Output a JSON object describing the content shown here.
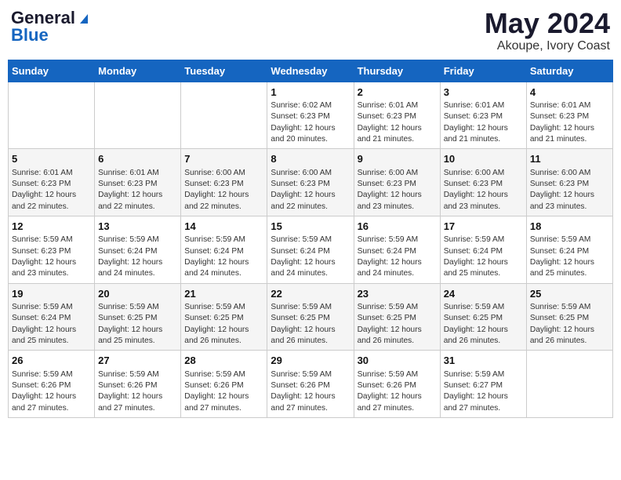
{
  "header": {
    "logo_line1": "General",
    "logo_line2": "Blue",
    "title": "May 2024",
    "subtitle": "Akoupe, Ivory Coast"
  },
  "days_of_week": [
    "Sunday",
    "Monday",
    "Tuesday",
    "Wednesday",
    "Thursday",
    "Friday",
    "Saturday"
  ],
  "weeks": [
    [
      {
        "day": "",
        "info": ""
      },
      {
        "day": "",
        "info": ""
      },
      {
        "day": "",
        "info": ""
      },
      {
        "day": "1",
        "info": "Sunrise: 6:02 AM\nSunset: 6:23 PM\nDaylight: 12 hours\nand 20 minutes."
      },
      {
        "day": "2",
        "info": "Sunrise: 6:01 AM\nSunset: 6:23 PM\nDaylight: 12 hours\nand 21 minutes."
      },
      {
        "day": "3",
        "info": "Sunrise: 6:01 AM\nSunset: 6:23 PM\nDaylight: 12 hours\nand 21 minutes."
      },
      {
        "day": "4",
        "info": "Sunrise: 6:01 AM\nSunset: 6:23 PM\nDaylight: 12 hours\nand 21 minutes."
      }
    ],
    [
      {
        "day": "5",
        "info": "Sunrise: 6:01 AM\nSunset: 6:23 PM\nDaylight: 12 hours\nand 22 minutes."
      },
      {
        "day": "6",
        "info": "Sunrise: 6:01 AM\nSunset: 6:23 PM\nDaylight: 12 hours\nand 22 minutes."
      },
      {
        "day": "7",
        "info": "Sunrise: 6:00 AM\nSunset: 6:23 PM\nDaylight: 12 hours\nand 22 minutes."
      },
      {
        "day": "8",
        "info": "Sunrise: 6:00 AM\nSunset: 6:23 PM\nDaylight: 12 hours\nand 22 minutes."
      },
      {
        "day": "9",
        "info": "Sunrise: 6:00 AM\nSunset: 6:23 PM\nDaylight: 12 hours\nand 23 minutes."
      },
      {
        "day": "10",
        "info": "Sunrise: 6:00 AM\nSunset: 6:23 PM\nDaylight: 12 hours\nand 23 minutes."
      },
      {
        "day": "11",
        "info": "Sunrise: 6:00 AM\nSunset: 6:23 PM\nDaylight: 12 hours\nand 23 minutes."
      }
    ],
    [
      {
        "day": "12",
        "info": "Sunrise: 5:59 AM\nSunset: 6:23 PM\nDaylight: 12 hours\nand 23 minutes."
      },
      {
        "day": "13",
        "info": "Sunrise: 5:59 AM\nSunset: 6:24 PM\nDaylight: 12 hours\nand 24 minutes."
      },
      {
        "day": "14",
        "info": "Sunrise: 5:59 AM\nSunset: 6:24 PM\nDaylight: 12 hours\nand 24 minutes."
      },
      {
        "day": "15",
        "info": "Sunrise: 5:59 AM\nSunset: 6:24 PM\nDaylight: 12 hours\nand 24 minutes."
      },
      {
        "day": "16",
        "info": "Sunrise: 5:59 AM\nSunset: 6:24 PM\nDaylight: 12 hours\nand 24 minutes."
      },
      {
        "day": "17",
        "info": "Sunrise: 5:59 AM\nSunset: 6:24 PM\nDaylight: 12 hours\nand 25 minutes."
      },
      {
        "day": "18",
        "info": "Sunrise: 5:59 AM\nSunset: 6:24 PM\nDaylight: 12 hours\nand 25 minutes."
      }
    ],
    [
      {
        "day": "19",
        "info": "Sunrise: 5:59 AM\nSunset: 6:24 PM\nDaylight: 12 hours\nand 25 minutes."
      },
      {
        "day": "20",
        "info": "Sunrise: 5:59 AM\nSunset: 6:25 PM\nDaylight: 12 hours\nand 25 minutes."
      },
      {
        "day": "21",
        "info": "Sunrise: 5:59 AM\nSunset: 6:25 PM\nDaylight: 12 hours\nand 26 minutes."
      },
      {
        "day": "22",
        "info": "Sunrise: 5:59 AM\nSunset: 6:25 PM\nDaylight: 12 hours\nand 26 minutes."
      },
      {
        "day": "23",
        "info": "Sunrise: 5:59 AM\nSunset: 6:25 PM\nDaylight: 12 hours\nand 26 minutes."
      },
      {
        "day": "24",
        "info": "Sunrise: 5:59 AM\nSunset: 6:25 PM\nDaylight: 12 hours\nand 26 minutes."
      },
      {
        "day": "25",
        "info": "Sunrise: 5:59 AM\nSunset: 6:25 PM\nDaylight: 12 hours\nand 26 minutes."
      }
    ],
    [
      {
        "day": "26",
        "info": "Sunrise: 5:59 AM\nSunset: 6:26 PM\nDaylight: 12 hours\nand 27 minutes."
      },
      {
        "day": "27",
        "info": "Sunrise: 5:59 AM\nSunset: 6:26 PM\nDaylight: 12 hours\nand 27 minutes."
      },
      {
        "day": "28",
        "info": "Sunrise: 5:59 AM\nSunset: 6:26 PM\nDaylight: 12 hours\nand 27 minutes."
      },
      {
        "day": "29",
        "info": "Sunrise: 5:59 AM\nSunset: 6:26 PM\nDaylight: 12 hours\nand 27 minutes."
      },
      {
        "day": "30",
        "info": "Sunrise: 5:59 AM\nSunset: 6:26 PM\nDaylight: 12 hours\nand 27 minutes."
      },
      {
        "day": "31",
        "info": "Sunrise: 5:59 AM\nSunset: 6:27 PM\nDaylight: 12 hours\nand 27 minutes."
      },
      {
        "day": "",
        "info": ""
      }
    ]
  ]
}
